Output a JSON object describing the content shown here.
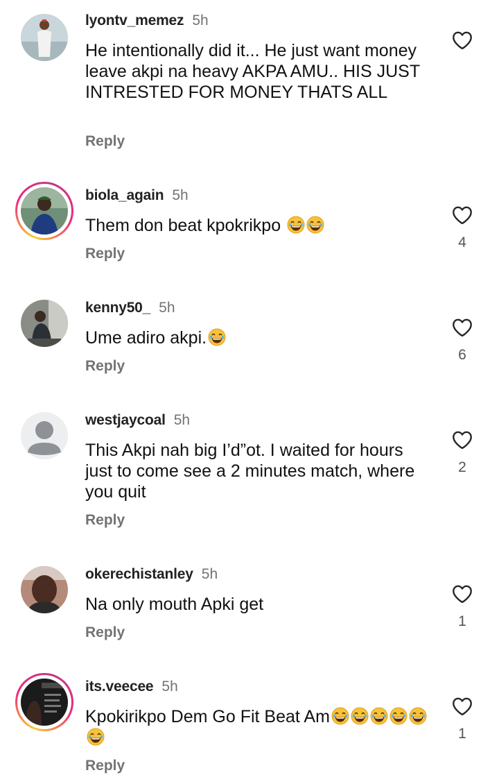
{
  "comments": [
    {
      "username": "lyontv_memez",
      "time": "5h",
      "text": "He intentionally did it... He just want money leave akpi na heavy AKPA AMU.. HIS JUST INTRESTED FOR MONEY THATS ALL",
      "reply": "Reply",
      "likes": ""
    },
    {
      "username": "biola_again",
      "time": "5h",
      "text": "Them don beat kpokrikpo",
      "reply": "Reply",
      "likes": "4"
    },
    {
      "username": "kenny50_",
      "time": "5h",
      "text": "Ume adiro akpi.",
      "reply": "Reply",
      "likes": "6"
    },
    {
      "username": "westjaycoal",
      "time": "5h",
      "text": "This Akpi nah big I’d”ot. I waited for hours just to come see a 2 minutes match, where you quit",
      "reply": "Reply",
      "likes": "2"
    },
    {
      "username": "okerechistanley",
      "time": "5h",
      "text": "Na only mouth Apki get",
      "reply": "Reply",
      "likes": "1"
    },
    {
      "username": "its.veecee",
      "time": "5h",
      "text": "Kpokirikpo Dem Go Fit Beat Am",
      "reply": "Reply",
      "likes": "1"
    }
  ],
  "icons": {
    "like": "heart-outline-icon",
    "emoji": "laughing-emoji-icon"
  },
  "colors": {
    "muted": "#737373",
    "story_ring_start": "#f9ce34",
    "story_ring_end": "#c13584",
    "emoji_face": "#f7c23b"
  }
}
